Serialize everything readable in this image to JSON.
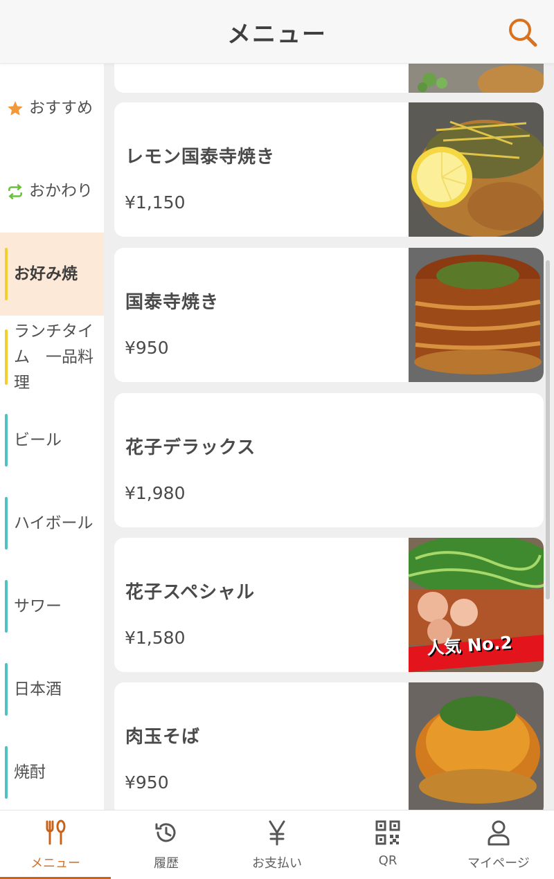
{
  "header": {
    "title": "メニュー",
    "search_icon": "search-icon"
  },
  "colors": {
    "accent": "#d9711f",
    "active_category_bg": "#fde9d8",
    "yellow_bar": "#f2cf2e",
    "teal_bar": "#4fc3c3",
    "star": "#f29a3a",
    "refresh": "#6cbf3a"
  },
  "sidebar": {
    "items": [
      {
        "label": "おすすめ",
        "icon": "star-icon"
      },
      {
        "label": "おかわり",
        "icon": "repeat-icon"
      },
      {
        "label": "お好み焼"
      },
      {
        "label": "ランチタイム　一品料理"
      },
      {
        "label": "ビール"
      },
      {
        "label": "ハイボール"
      },
      {
        "label": "サワー"
      },
      {
        "label": "日本酒"
      },
      {
        "label": "焼酎"
      }
    ],
    "active": "お好み焼"
  },
  "menu_items": [
    {
      "name": "レモン国泰寺焼き",
      "price": "¥1,150",
      "image": "lemon-okonomiyaki-photo"
    },
    {
      "name": "国泰寺焼き",
      "price": "¥950",
      "image": "kokutaiji-okonomiyaki-photo"
    },
    {
      "name": "花子デラックス",
      "price": "¥1,980"
    },
    {
      "name": "花子スペシャル",
      "price": "¥1,580",
      "image": "special-okonomiyaki-photo",
      "badge": "人気 No.2"
    },
    {
      "name": "肉玉そば",
      "price": "¥950",
      "image": "nikutama-soba-photo"
    }
  ],
  "bottom_nav": {
    "items": [
      {
        "label": "メニュー",
        "icon": "fork-spoon-icon"
      },
      {
        "label": "履歴",
        "icon": "history-icon"
      },
      {
        "label": "お支払い",
        "icon": "yen-icon"
      },
      {
        "label": "QR",
        "icon": "qr-code-icon"
      },
      {
        "label": "マイページ",
        "icon": "user-icon"
      }
    ],
    "active": "メニュー"
  }
}
